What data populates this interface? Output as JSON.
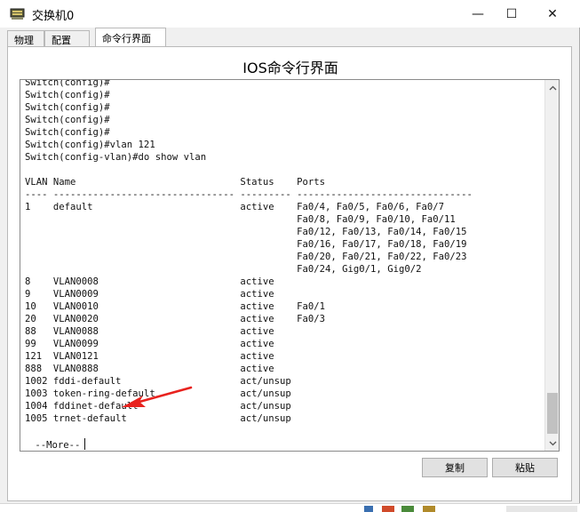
{
  "window": {
    "title": "交换机0",
    "controls": {
      "minimize": "—",
      "maximize": "☐",
      "close": "✕"
    }
  },
  "tabs": [
    {
      "label": "物理"
    },
    {
      "label": "配置"
    },
    {
      "label": "命令行界面"
    }
  ],
  "active_tab": "命令行界面",
  "panel": {
    "title": "IOS命令行界面"
  },
  "terminal": {
    "lines": [
      "Switch(config)#",
      "Switch(config)#",
      "Switch(config)#",
      "Switch(config)#",
      "Switch(config)#",
      "Switch(config)#vlan 121",
      "Switch(config-vlan)#do show vlan",
      "",
      "VLAN Name                             Status    Ports",
      "---- -------------------------------- --------- -------------------------------",
      "1    default                          active    Fa0/4, Fa0/5, Fa0/6, Fa0/7",
      "                                                Fa0/8, Fa0/9, Fa0/10, Fa0/11",
      "                                                Fa0/12, Fa0/13, Fa0/14, Fa0/15",
      "                                                Fa0/16, Fa0/17, Fa0/18, Fa0/19",
      "                                                Fa0/20, Fa0/21, Fa0/22, Fa0/23",
      "                                                Fa0/24, Gig0/1, Gig0/2",
      "8    VLAN0008                         active    ",
      "9    VLAN0009                         active    ",
      "10   VLAN0010                         active    Fa0/1",
      "20   VLAN0020                         active    Fa0/3",
      "88   VLAN0088                         active    ",
      "99   VLAN0099                         active    ",
      "121  VLAN0121                         active    ",
      "888  VLAN0888                         active    ",
      "1002 fddi-default                     act/unsup ",
      "1003 token-ring-default               act/unsup ",
      "1004 fddinet-default                  act/unsup ",
      "1005 trnet-default                    act/unsup "
    ],
    "more_prompt": " --More--"
  },
  "buttons": {
    "copy": "复制",
    "paste": "粘贴"
  },
  "colors": {
    "arrow": "#e8221e",
    "scroll_thumb": "#c1c1c1"
  },
  "icons": {
    "app": "switch-icon",
    "scroll_up": "chevron-up-icon",
    "scroll_down": "chevron-down-icon"
  }
}
